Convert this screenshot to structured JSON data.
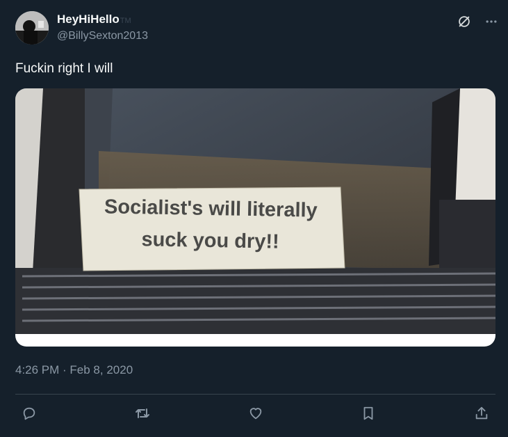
{
  "author": {
    "display_name": "HeyHiHello",
    "badge_text": "TM",
    "handle": "@BillySexton2013"
  },
  "header_icons": [
    "grok-slash-icon",
    "more-icon"
  ],
  "tweet": {
    "text": "Fuckin right I will",
    "timestamp": "4:26 PM · Feb 8, 2020"
  },
  "media": {
    "sign_lines": [
      "Socialist's will literally",
      "suck you dry!!"
    ]
  },
  "actions": [
    {
      "name": "reply-button",
      "icon": "reply-icon"
    },
    {
      "name": "retweet-button",
      "icon": "retweet-icon"
    },
    {
      "name": "like-button",
      "icon": "heart-icon"
    },
    {
      "name": "bookmark-button",
      "icon": "bookmark-icon"
    },
    {
      "name": "share-button",
      "icon": "share-icon"
    }
  ],
  "colors": {
    "background": "#15202b",
    "primary_text": "#f7f9f9",
    "secondary_text": "#8b98a5",
    "divider": "#38444d"
  }
}
